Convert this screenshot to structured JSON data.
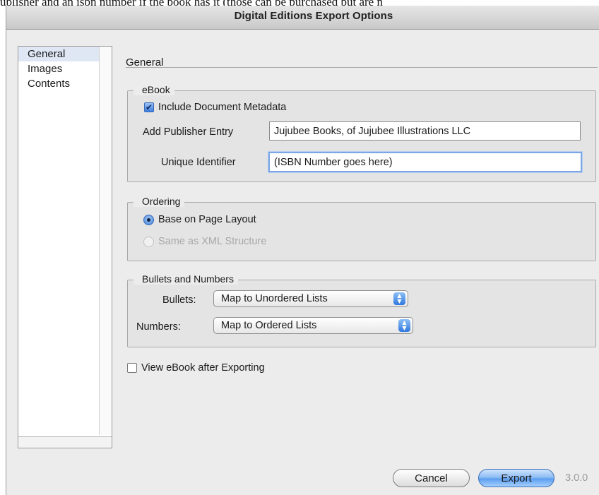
{
  "caption": "ublisher and an isbn number if the book has it (those can be purchased but are n",
  "window": {
    "title": "Digital Editions Export Options"
  },
  "sidebar": {
    "items": [
      {
        "label": "General",
        "selected": true
      },
      {
        "label": "Images",
        "selected": false
      },
      {
        "label": "Contents",
        "selected": false
      }
    ]
  },
  "main": {
    "section_title": "General",
    "ebook": {
      "legend": "eBook",
      "include_metadata": {
        "label": "Include Document Metadata",
        "checked": true
      },
      "publisher": {
        "label": "Add Publisher Entry",
        "value": "Jujubee Books, of Jujubee Illustrations LLC"
      },
      "identifier": {
        "label": "Unique Identifier",
        "value": "(ISBN Number goes here)"
      }
    },
    "ordering": {
      "legend": "Ordering",
      "options": [
        {
          "label": "Base on Page Layout",
          "selected": true,
          "enabled": true
        },
        {
          "label": "Same as XML Structure",
          "selected": false,
          "enabled": false
        }
      ]
    },
    "bullets_numbers": {
      "legend": "Bullets and Numbers",
      "bullets": {
        "label": "Bullets:",
        "value": "Map to Unordered Lists"
      },
      "numbers": {
        "label": "Numbers:",
        "value": "Map to Ordered Lists"
      }
    },
    "view_after": {
      "label": "View eBook after Exporting",
      "checked": false
    }
  },
  "footer": {
    "cancel_label": "Cancel",
    "export_label": "Export",
    "version": "3.0.0"
  }
}
